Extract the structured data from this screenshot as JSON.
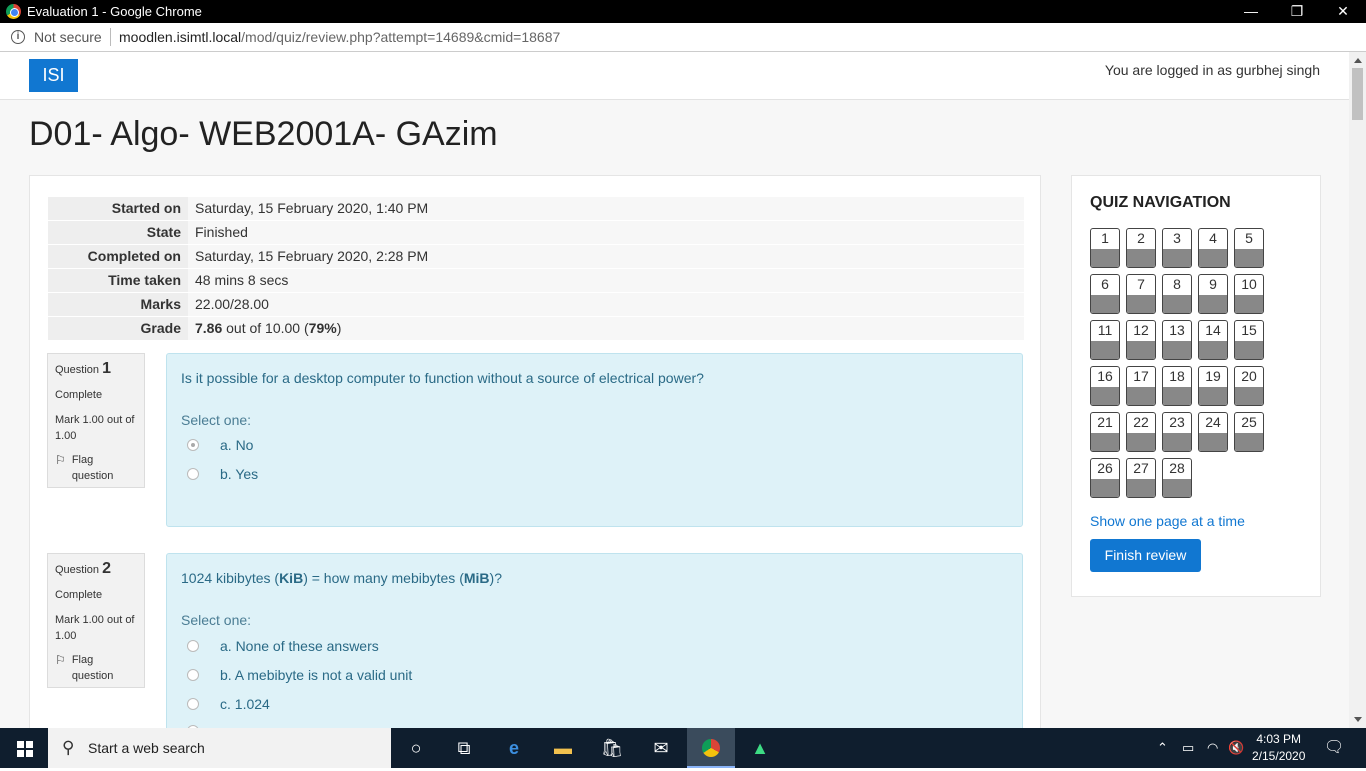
{
  "window": {
    "title": "Evaluation 1 - Google Chrome",
    "minimize": "—",
    "restore": "❐",
    "close": "✕"
  },
  "address": {
    "security": "Not secure",
    "host": "moodlen.isimtl.local",
    "path": "/mod/quiz/review.php?attempt=14689&cmid=18687"
  },
  "navbar": {
    "brand": "ISI",
    "login_text": "You are logged in as gurbhej singh"
  },
  "page_title": "D01- Algo- WEB2001A- GAzim",
  "summary": [
    {
      "label": "Started on",
      "value": "Saturday, 15 February 2020, 1:40 PM"
    },
    {
      "label": "State",
      "value": "Finished"
    },
    {
      "label": "Completed on",
      "value": "Saturday, 15 February 2020, 2:28 PM"
    },
    {
      "label": "Time taken",
      "value": "48 mins 8 secs"
    },
    {
      "label": "Marks",
      "value": "22.00/28.00"
    }
  ],
  "grade": {
    "label": "Grade",
    "score": "7.86",
    "out_of": " out of 10.00 (",
    "percent": "79%",
    "close": ")"
  },
  "questions": [
    {
      "label": "Question",
      "number": "1",
      "status": "Complete",
      "mark": "Mark 1.00 out of 1.00",
      "flag": "Flag question",
      "text": "Is it possible for a desktop computer to function without a source of electrical power?",
      "prompt": "Select one:",
      "options": [
        "a. No",
        "b. Yes"
      ],
      "selected": 0
    },
    {
      "label": "Question",
      "number": "2",
      "status": "Complete",
      "mark": "Mark 1.00 out of 1.00",
      "flag": "Flag question",
      "text_parts": [
        "1024 kibibytes (",
        "KiB",
        ") = how many mebibytes (",
        "MiB",
        ")?"
      ],
      "prompt": "Select one:",
      "options": [
        "a. None of these answers",
        "b. A mebibyte is not a valid unit",
        "c. 1.024"
      ]
    }
  ],
  "quiz_nav": {
    "title": "QUIZ NAVIGATION",
    "buttons": [
      "1",
      "2",
      "3",
      "4",
      "5",
      "6",
      "7",
      "8",
      "9",
      "10",
      "11",
      "12",
      "13",
      "14",
      "15",
      "16",
      "17",
      "18",
      "19",
      "20",
      "21",
      "22",
      "23",
      "24",
      "25",
      "26",
      "27",
      "28"
    ],
    "show_one_page": "Show one page at a time",
    "finish_review": "Finish review"
  },
  "taskbar": {
    "search_placeholder": "Start a web search",
    "time": "4:03 PM",
    "date": "2/15/2020"
  }
}
